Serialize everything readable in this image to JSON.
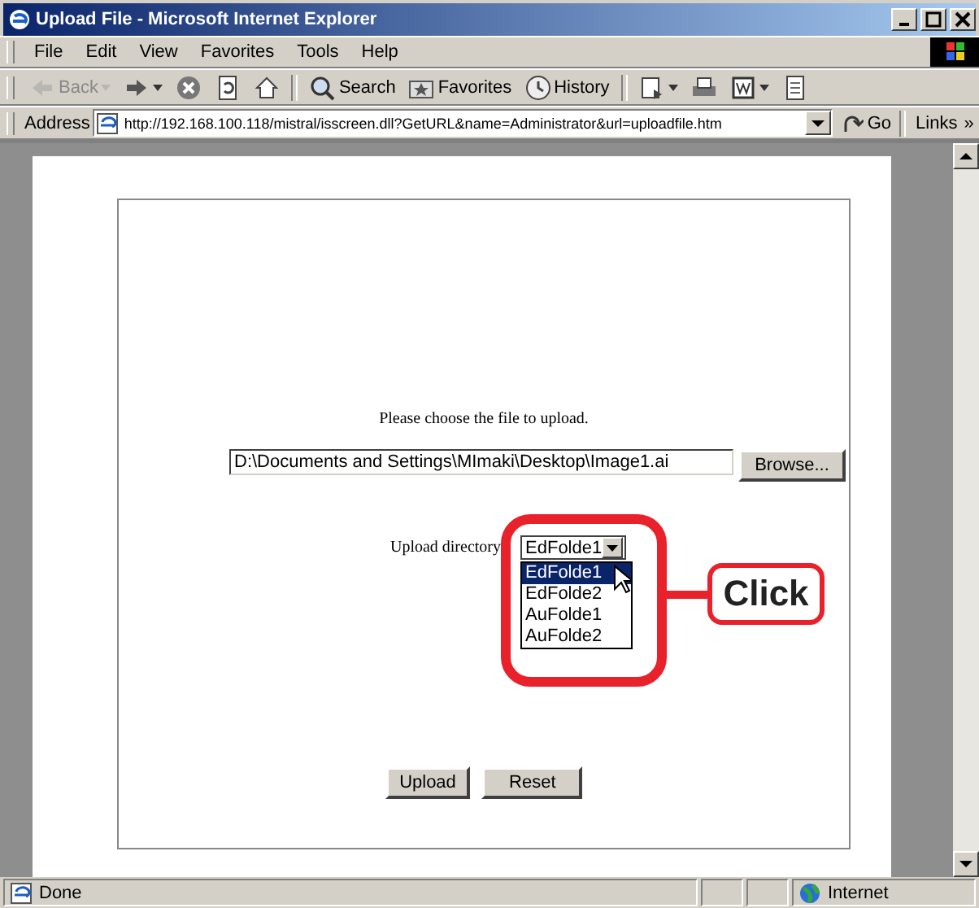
{
  "window": {
    "title": "Upload File - Microsoft Internet Explorer"
  },
  "menu": [
    "File",
    "Edit",
    "View",
    "Favorites",
    "Tools",
    "Help"
  ],
  "toolbar": [
    {
      "kind": "back",
      "label": "Back",
      "disabled": true
    },
    {
      "kind": "forward",
      "disabled": false
    },
    {
      "kind": "stop",
      "disabled": false
    },
    {
      "kind": "refresh",
      "disabled": false
    },
    {
      "kind": "home",
      "disabled": false
    },
    {
      "kind": "search",
      "label": "Search",
      "disabled": false
    },
    {
      "kind": "favorites",
      "label": "Favorites",
      "disabled": false
    },
    {
      "kind": "history",
      "label": "History",
      "disabled": false
    },
    {
      "kind": "mail",
      "disabled": false
    },
    {
      "kind": "print",
      "disabled": false
    },
    {
      "kind": "edit",
      "disabled": false
    },
    {
      "kind": "discuss",
      "disabled": false
    }
  ],
  "address": {
    "label": "Address",
    "value": "http://192.168.100.118/mistral/isscreen.dll?GetURL&name=Administrator&url=uploadfile.htm",
    "go": "Go",
    "links": "Links",
    "more": "»"
  },
  "form": {
    "prompt": "Please choose the file to upload.",
    "file_value": "D:\\Documents and Settings\\MImaki\\Desktop\\Image1.ai",
    "browse": "Browse...",
    "dir_label": "Upload directory",
    "select_value": "EdFolde1",
    "options": [
      {
        "label": "EdFolde1",
        "selected": true
      },
      {
        "label": "EdFolde2",
        "selected": false
      },
      {
        "label": "AuFolde1",
        "selected": false
      },
      {
        "label": "AuFolde2",
        "selected": false
      }
    ],
    "upload": "Upload",
    "reset": "Reset"
  },
  "callout": {
    "label": "Click"
  },
  "status_bar": {
    "text": "Done",
    "zone": "Internet"
  }
}
